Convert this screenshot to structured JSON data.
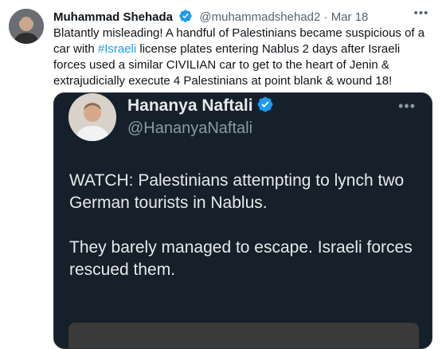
{
  "tweet": {
    "author_name": "Muhammad Shehada",
    "author_handle": "@muhammadshehad2",
    "separator": "·",
    "date": "Mar 18",
    "more_icon": "more-horizontal-icon",
    "text_before_hashtag": "Blatantly misleading! A handful of Palestinians became suspicious of a car with ",
    "hashtag": "#Israeli",
    "text_after_hashtag": " license plates entering Nablus 2 days after Israeli forces used a similar CIVILIAN car to get to the heart of Jenin & extrajudicially execute 4 Palestinians at point blank & wound 18!"
  },
  "quoted": {
    "author_name": "Hananya Naftali",
    "author_handle": "@HananyaNaftali",
    "paragraph1": "WATCH: Palestinians attempting to lynch two German tourists in Nablus.",
    "paragraph2": "They barely managed to escape. Israeli forces rescued them."
  },
  "colors": {
    "link": "#1d9bf0",
    "verified": "#1d9bf0",
    "quote_background": "#15202b"
  }
}
